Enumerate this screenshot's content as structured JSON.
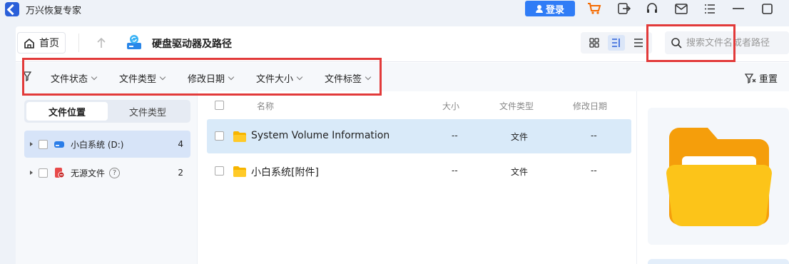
{
  "app": {
    "title": "万兴恢复专家",
    "login_label": "登录"
  },
  "toolbar": {
    "home_label": "首页",
    "breadcrumb": "硬盘驱动器及路径",
    "search_placeholder": "搜索文件名或者路径"
  },
  "filters": {
    "items": [
      "文件状态",
      "文件类型",
      "修改日期",
      "文件大小",
      "文件标签"
    ],
    "reset_label": "重置"
  },
  "sidebar": {
    "tabs": [
      "文件位置",
      "文件类型"
    ],
    "tree": [
      {
        "label": "小白系统 (D:)",
        "count": "4"
      },
      {
        "label": "无源文件",
        "count": "2"
      }
    ]
  },
  "list": {
    "headers": {
      "name": "名称",
      "size": "大小",
      "type": "文件类型",
      "modified": "修改日期"
    },
    "rows": [
      {
        "name": "System Volume Information",
        "size": "--",
        "type": "文件",
        "modified": "--"
      },
      {
        "name": "小白系统[附件]",
        "size": "--",
        "type": "文件",
        "modified": "--"
      }
    ]
  },
  "colors": {
    "accent": "#2f7cf6",
    "highlight": "#e23a3a",
    "folder": "#f7b500",
    "cart": "#f56a00"
  }
}
